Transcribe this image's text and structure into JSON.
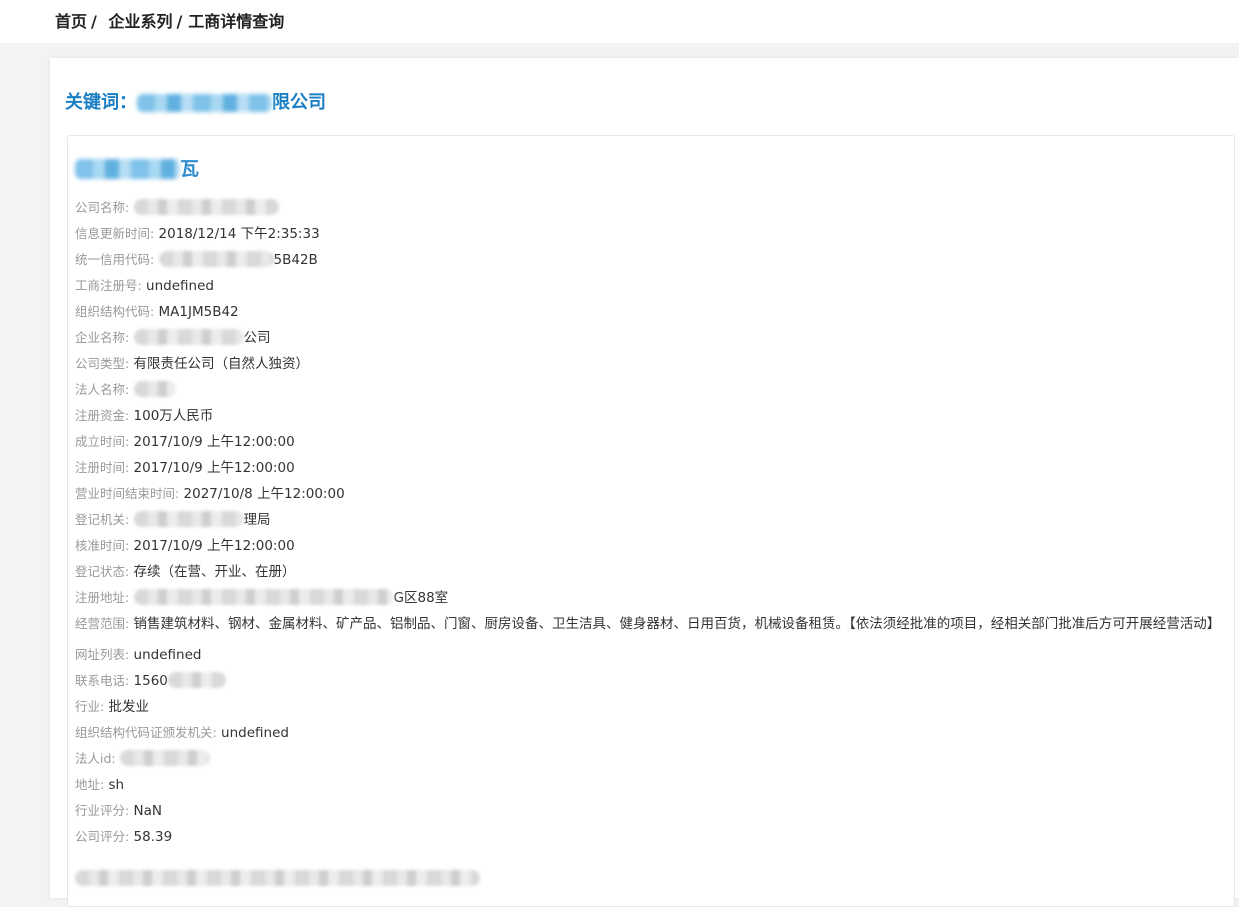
{
  "breadcrumb": {
    "home": "首页",
    "section": "企业系列",
    "page": "工商详情查询",
    "separator": "/"
  },
  "keyword": {
    "label": "关键词：",
    "value_suffix": "限公司"
  },
  "company": {
    "title_suffix": "瓦"
  },
  "fields": [
    {
      "label": "公司名称:",
      "value": ""
    },
    {
      "label": "信息更新时间:",
      "value": "2018/12/14 下午2:35:33"
    },
    {
      "label": "统一信用代码:",
      "value": "5B42B"
    },
    {
      "label": "工商注册号:",
      "value": "undefined"
    },
    {
      "label": "组织结构代码:",
      "value": "MA1JM5B42"
    },
    {
      "label": "企业名称:",
      "value": "公司"
    },
    {
      "label": "公司类型:",
      "value": "有限责任公司（自然人独资）"
    },
    {
      "label": "法人名称:",
      "value": ""
    },
    {
      "label": "注册资金:",
      "value": "100万人民币"
    },
    {
      "label": "成立时间:",
      "value": "2017/10/9 上午12:00:00"
    },
    {
      "label": "注册时间:",
      "value": "2017/10/9 上午12:00:00"
    },
    {
      "label": "营业时间结束时间:",
      "value": "2027/10/8 上午12:00:00"
    },
    {
      "label": "登记机关:",
      "value": "理局"
    },
    {
      "label": "核准时间:",
      "value": "2017/10/9 上午12:00:00"
    },
    {
      "label": "登记状态:",
      "value": "存续（在营、开业、在册）"
    },
    {
      "label": "注册地址:",
      "value": "G区88室"
    },
    {
      "label": "经营范围:",
      "value": "销售建筑材料、钢材、金属材料、矿产品、铝制品、门窗、厨房设备、卫生洁具、健身器材、日用百货，机械设备租赁。【依法须经批准的项目，经相关部门批准后方可开展经营活动】"
    },
    {
      "label": "网址列表:",
      "value": "undefined"
    },
    {
      "label": "联系电话:",
      "value": "1560"
    },
    {
      "label": "行业:",
      "value": "批发业"
    },
    {
      "label": "组织结构代码证颁发机关:",
      "value": "undefined"
    },
    {
      "label": "法人id:",
      "value": ""
    },
    {
      "label": "地址:",
      "value": "sh"
    },
    {
      "label": "行业评分:",
      "value": "NaN"
    },
    {
      "label": "公司评分:",
      "value": "58.39"
    }
  ],
  "colors": {
    "accent": "#1b7fc4",
    "label": "#999999",
    "value": "#333333"
  }
}
